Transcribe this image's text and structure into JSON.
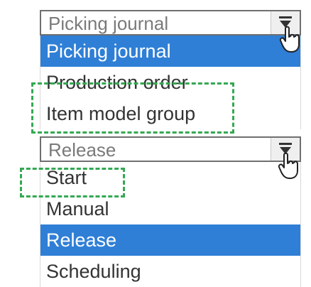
{
  "combo_picking": {
    "value": "Picking journal",
    "options": [
      "Picking journal",
      "Production order",
      "Item model group"
    ],
    "selected_index": 0
  },
  "combo_release": {
    "value": "Release",
    "options": [
      "Start",
      "Manual",
      "Release",
      "Scheduling"
    ],
    "selected_index": 2
  },
  "colors": {
    "selection": "#2f7fd6",
    "highlight_annotation": "#33a853",
    "field_border": "#6f6f6f"
  },
  "icons": {
    "dropdown_arrow": "chevron-down-icon",
    "cursor": "hand-pointer-icon"
  }
}
